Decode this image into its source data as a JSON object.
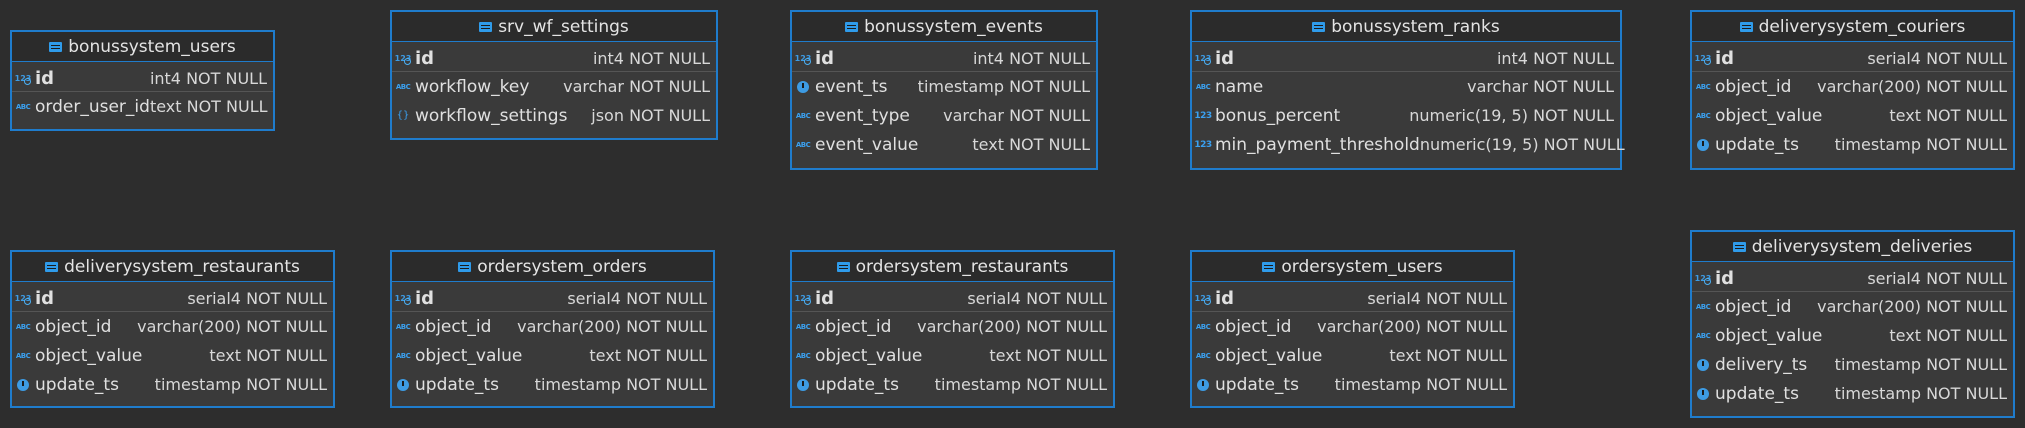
{
  "tables": [
    {
      "title": "bonussystem_users",
      "pk": {
        "name": "id",
        "type": "int4 NOT NULL",
        "icon": "primary-key-number-icon"
      },
      "columns": [
        {
          "name": "order_user_id",
          "type": "text NOT NULL",
          "icon": "string-type-icon"
        }
      ]
    },
    {
      "title": "srv_wf_settings",
      "pk": {
        "name": "id",
        "type": "int4 NOT NULL",
        "icon": "primary-key-number-icon"
      },
      "columns": [
        {
          "name": "workflow_key",
          "type": "varchar NOT NULL",
          "icon": "string-type-icon"
        },
        {
          "name": "workflow_settings",
          "type": "json NOT NULL",
          "icon": "json-type-icon"
        }
      ]
    },
    {
      "title": "bonussystem_events",
      "pk": {
        "name": "id",
        "type": "int4 NOT NULL",
        "icon": "primary-key-number-icon"
      },
      "columns": [
        {
          "name": "event_ts",
          "type": "timestamp NOT NULL",
          "icon": "timestamp-type-icon"
        },
        {
          "name": "event_type",
          "type": "varchar NOT NULL",
          "icon": "string-type-icon"
        },
        {
          "name": "event_value",
          "type": "text NOT NULL",
          "icon": "string-type-icon"
        }
      ]
    },
    {
      "title": "bonussystem_ranks",
      "pk": {
        "name": "id",
        "type": "int4 NOT NULL",
        "icon": "primary-key-number-icon"
      },
      "columns": [
        {
          "name": "name",
          "type": "varchar NOT NULL",
          "icon": "string-type-icon"
        },
        {
          "name": "bonus_percent",
          "type": "numeric(19, 5) NOT NULL",
          "icon": "number-type-icon"
        },
        {
          "name": "min_payment_threshold",
          "type": "numeric(19, 5) NOT NULL",
          "icon": "number-type-icon"
        }
      ]
    },
    {
      "title": "deliverysystem_couriers",
      "pk": {
        "name": "id",
        "type": "serial4 NOT NULL",
        "icon": "primary-key-number-icon"
      },
      "columns": [
        {
          "name": "object_id",
          "type": "varchar(200) NOT NULL",
          "icon": "string-type-icon"
        },
        {
          "name": "object_value",
          "type": "text NOT NULL",
          "icon": "string-type-icon"
        },
        {
          "name": "update_ts",
          "type": "timestamp NOT NULL",
          "icon": "timestamp-type-icon"
        }
      ]
    },
    {
      "title": "deliverysystem_restaurants",
      "pk": {
        "name": "id",
        "type": "serial4 NOT NULL",
        "icon": "primary-key-number-icon"
      },
      "columns": [
        {
          "name": "object_id",
          "type": "varchar(200) NOT NULL",
          "icon": "string-type-icon"
        },
        {
          "name": "object_value",
          "type": "text NOT NULL",
          "icon": "string-type-icon"
        },
        {
          "name": "update_ts",
          "type": "timestamp NOT NULL",
          "icon": "timestamp-type-icon"
        }
      ]
    },
    {
      "title": "ordersystem_orders",
      "pk": {
        "name": "id",
        "type": "serial4 NOT NULL",
        "icon": "primary-key-number-icon"
      },
      "columns": [
        {
          "name": "object_id",
          "type": "varchar(200) NOT NULL",
          "icon": "string-type-icon"
        },
        {
          "name": "object_value",
          "type": "text NOT NULL",
          "icon": "string-type-icon"
        },
        {
          "name": "update_ts",
          "type": "timestamp NOT NULL",
          "icon": "timestamp-type-icon"
        }
      ]
    },
    {
      "title": "ordersystem_restaurants",
      "pk": {
        "name": "id",
        "type": "serial4 NOT NULL",
        "icon": "primary-key-number-icon"
      },
      "columns": [
        {
          "name": "object_id",
          "type": "varchar(200) NOT NULL",
          "icon": "string-type-icon"
        },
        {
          "name": "object_value",
          "type": "text NOT NULL",
          "icon": "string-type-icon"
        },
        {
          "name": "update_ts",
          "type": "timestamp NOT NULL",
          "icon": "timestamp-type-icon"
        }
      ]
    },
    {
      "title": "ordersystem_users",
      "pk": {
        "name": "id",
        "type": "serial4 NOT NULL",
        "icon": "primary-key-number-icon"
      },
      "columns": [
        {
          "name": "object_id",
          "type": "varchar(200) NOT NULL",
          "icon": "string-type-icon"
        },
        {
          "name": "object_value",
          "type": "text NOT NULL",
          "icon": "string-type-icon"
        },
        {
          "name": "update_ts",
          "type": "timestamp NOT NULL",
          "icon": "timestamp-type-icon"
        }
      ]
    },
    {
      "title": "deliverysystem_deliveries",
      "pk": {
        "name": "id",
        "type": "serial4 NOT NULL",
        "icon": "primary-key-number-icon"
      },
      "columns": [
        {
          "name": "object_id",
          "type": "varchar(200) NOT NULL",
          "icon": "string-type-icon"
        },
        {
          "name": "object_value",
          "type": "text NOT NULL",
          "icon": "string-type-icon"
        },
        {
          "name": "delivery_ts",
          "type": "timestamp NOT NULL",
          "icon": "timestamp-type-icon"
        },
        {
          "name": "update_ts",
          "type": "timestamp NOT NULL",
          "icon": "timestamp-type-icon"
        }
      ]
    }
  ],
  "colors": {
    "background": "#2d2d2d",
    "border": "#1f7ccc",
    "header_bg": "#2b2b2b",
    "body_bg": "#3a3a3a",
    "icon_blue": "#3aa0f0"
  }
}
